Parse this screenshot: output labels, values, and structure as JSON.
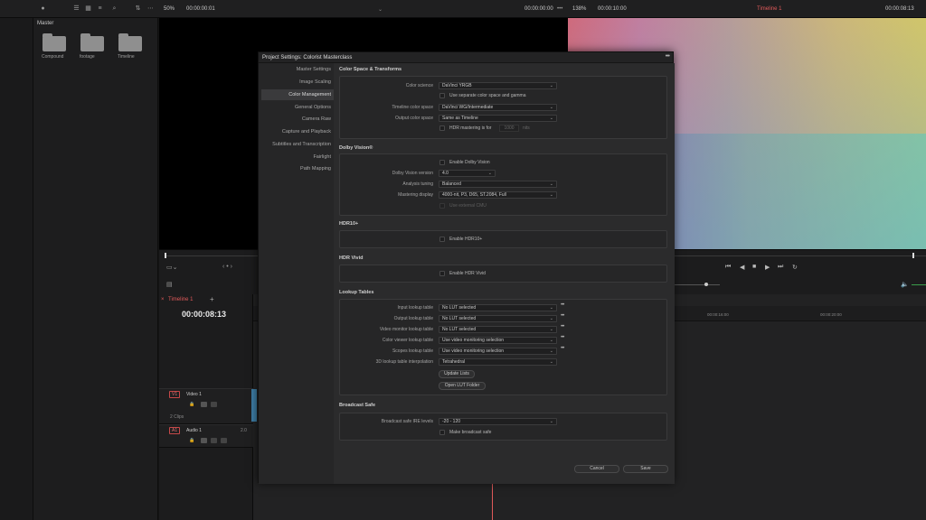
{
  "topbar": {
    "zoom_left": "50%",
    "source_timecode": "00:00:00:01",
    "program_timecode_left": "00:00:00:00",
    "zoom_right": "138%",
    "duration": "00:00:10:00",
    "timeline_name": "Timeline 1",
    "program_timecode_right": "00:00:08:13"
  },
  "media_pool": {
    "header": "Master",
    "folders": [
      "Compound",
      "footage",
      "Timeline"
    ]
  },
  "timeline": {
    "tab_label": "Timeline 1",
    "timecode": "00:00:08:13",
    "ruler_marks": [
      "00:00:16:00",
      "00:00:20:00"
    ],
    "tracks": [
      {
        "badge": "V1",
        "name": "Video 1",
        "info": "2 Clips"
      },
      {
        "badge": "A1",
        "name": "Audio 1",
        "info": "2.0"
      }
    ]
  },
  "dialog": {
    "title": "Project Settings:  Colorist Masterclass",
    "more": "•••",
    "nav": [
      "Master Settings",
      "Image Scaling",
      "Color Management",
      "General Options",
      "Camera Raw",
      "Capture and Playback",
      "Subtitles and Transcription",
      "Fairlight",
      "Path Mapping"
    ],
    "active_nav": "Color Management",
    "cst": {
      "title": "Color Space & Transforms",
      "color_science_label": "Color science",
      "color_science_value": "DaVinci YRGB",
      "separate_label": "Use separate color space and gamma",
      "timeline_cs_label": "Timeline color space",
      "timeline_cs_value": "DaVinci WG/Intermediate",
      "output_cs_label": "Output color space",
      "output_cs_value": "Same as Timeline",
      "hdr_label": "HDR mastering is for",
      "hdr_value": "1000",
      "hdr_unit": "nits"
    },
    "dolby": {
      "title": "Dolby Vision®",
      "enable_label": "Enable Dolby Vision",
      "version_label": "Dolby Vision version",
      "version_value": "4.0",
      "tuning_label": "Analysis tuning",
      "tuning_value": "Balanced",
      "mastering_label": "Mastering display",
      "mastering_value": "4000-nit, P3, D65, ST.2084, Full",
      "external_cmu_label": "Use external CMU"
    },
    "hdr10": {
      "title": "HDR10+",
      "enable_label": "Enable HDR10+"
    },
    "hdrvivid": {
      "title": "HDR Vivid",
      "enable_label": "Enable HDR Vivid"
    },
    "lut": {
      "title": "Lookup Tables",
      "rows": [
        {
          "label": "Input lookup table",
          "value": "No LUT selected"
        },
        {
          "label": "Output lookup table",
          "value": "No LUT selected"
        },
        {
          "label": "Video monitor lookup table",
          "value": "No LUT selected"
        },
        {
          "label": "Color viewer lookup table",
          "value": "Use video monitoring selection"
        },
        {
          "label": "Scopes lookup table",
          "value": "Use video monitoring selection"
        }
      ],
      "interp_label": "3D lookup table interpolation",
      "interp_value": "Tetrahedral",
      "update_button": "Update Lists",
      "open_button": "Open LUT Folder"
    },
    "broadcast": {
      "title": "Broadcast Safe",
      "ire_label": "Broadcast safe IRE levels",
      "ire_value": "-20 - 120",
      "make_safe_label": "Make broadcast safe"
    },
    "cancel_button": "Cancel",
    "save_button": "Save"
  },
  "colors": {
    "accent_red": "#e05a5a",
    "dialog_bg": "#2b2b2c"
  }
}
